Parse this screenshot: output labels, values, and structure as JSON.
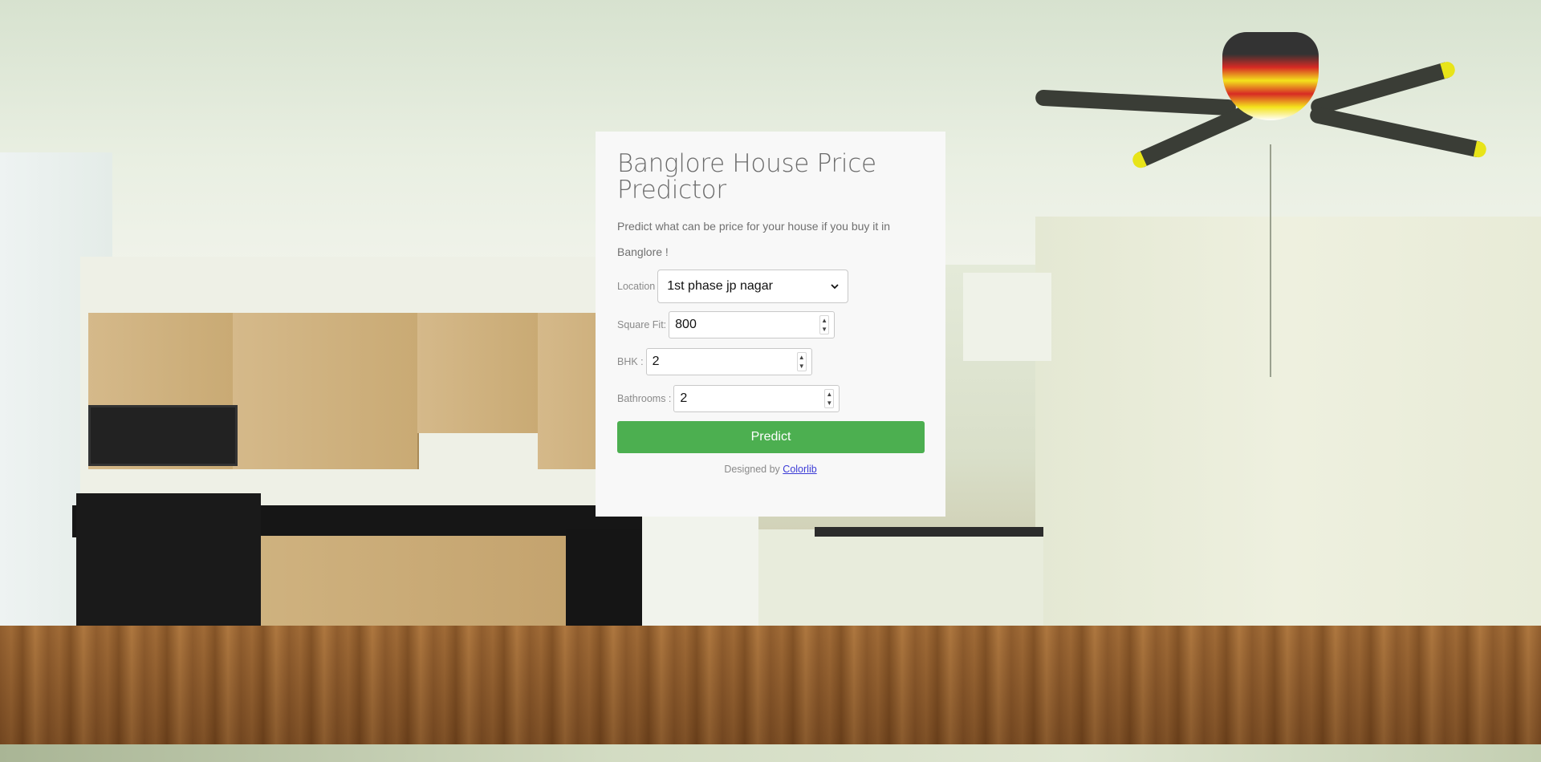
{
  "page": {
    "title": "Banglore House Price Predictor",
    "subtitle": "Predict what can be price for your house if you buy it in Banglore !"
  },
  "form": {
    "location": {
      "label": "Location",
      "selected": "1st phase jp nagar",
      "icon": "chevron-down-icon"
    },
    "square_fit": {
      "label": "Square Fit:",
      "value": "800"
    },
    "bhk": {
      "label": "BHK :",
      "value": "2"
    },
    "bathrooms": {
      "label": "Bathrooms :",
      "value": "2"
    },
    "submit_label": "Predict"
  },
  "footer": {
    "prefix": "Designed by",
    "link_text": "Colorlib"
  },
  "colors": {
    "button": "#4caf50",
    "card": "#f8f8f8",
    "link": "#3b3bd6"
  }
}
